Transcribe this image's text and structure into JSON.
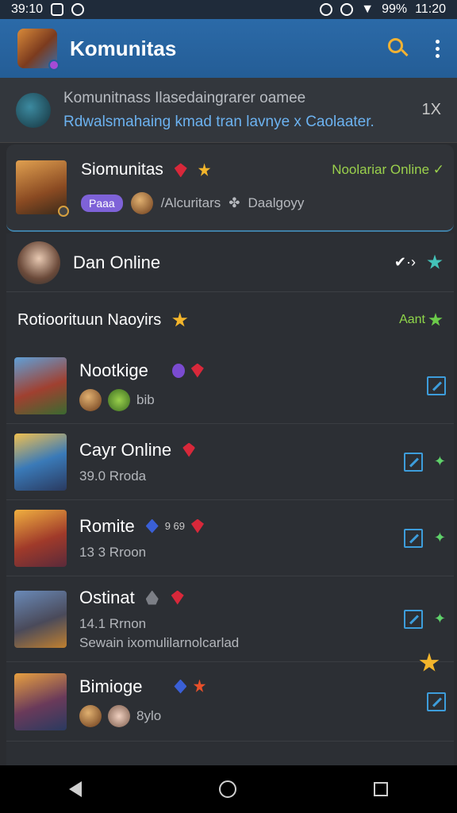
{
  "status": {
    "time_left": "39:10",
    "battery": "99%",
    "time_right": "11:20"
  },
  "app": {
    "title": "Komunitas"
  },
  "notice": {
    "line1": "Komunitnass Ilasedaingrarer oamee",
    "line2": "Rdwalsmahaing kmad tran lavnye x Caolaater.",
    "close": "1X"
  },
  "featured": {
    "name": "Siomunitas",
    "status": "Noolariar Online ✓",
    "pill": "Paaa",
    "meta_community": "/Alcuritars",
    "meta_category": "Daalgoyy"
  },
  "online_user": {
    "name": "Dan Online",
    "check": "✔·›"
  },
  "section": {
    "title": "Rotioorituun Naoyirs",
    "action": "Aant"
  },
  "games": [
    {
      "name": "Nootkige",
      "sub": "bib",
      "sub2": ""
    },
    {
      "name": "Cayr Online",
      "sub": "39.0 Rroda",
      "sub2": ""
    },
    {
      "name": "Romite",
      "sub": "13 3 Rroon",
      "sub2": "",
      "extra": "9 69"
    },
    {
      "name": "Ostinat",
      "sub": "14.1 Rrnon",
      "sub2": "Sewain ixomulilarnolcarlad"
    },
    {
      "name": "Bimioge",
      "sub": "8ylo",
      "sub2": ""
    }
  ],
  "colors": {
    "app_bar": "#245d96",
    "accent_green": "#9ad04c",
    "accent_blue": "#6cb2f0",
    "gold": "#f2b233"
  }
}
